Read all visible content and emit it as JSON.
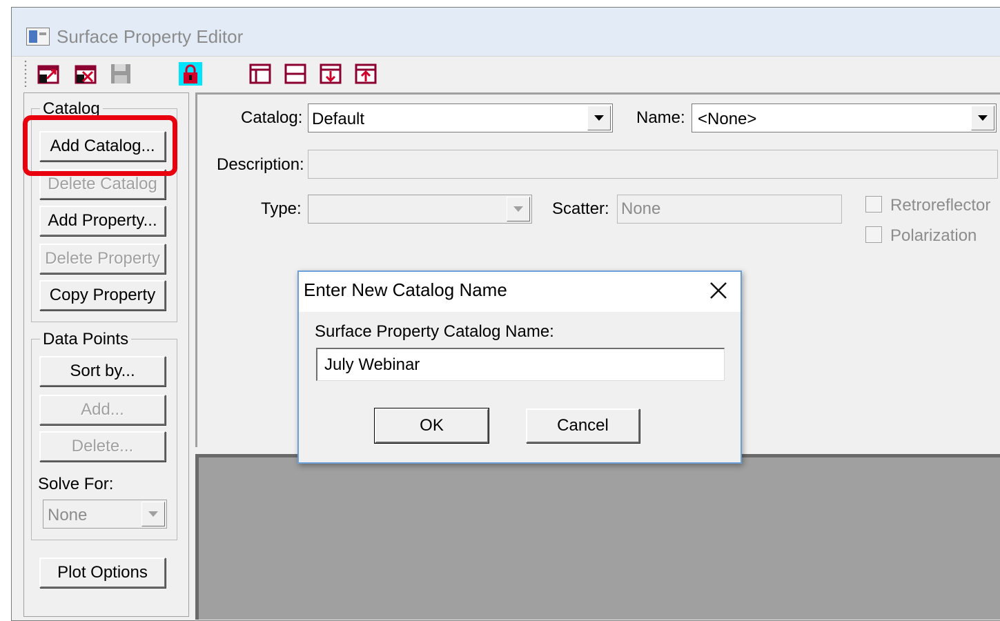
{
  "window": {
    "title": "Surface Property Editor"
  },
  "toolbar": {
    "icons": [
      "import-catalog-icon",
      "export-catalog-icon",
      "save-icon",
      "lock-icon",
      "layout-split-icon",
      "layout-rows-icon",
      "move-down-icon",
      "move-up-icon"
    ]
  },
  "catalog_group": {
    "label": "Catalog",
    "add_catalog": "Add Catalog...",
    "delete_catalog": "Delete Catalog",
    "add_property": "Add Property...",
    "delete_property": "Delete Property",
    "copy_property": "Copy Property"
  },
  "data_points_group": {
    "label": "Data Points",
    "sort_by": "Sort by...",
    "add": "Add...",
    "delete": "Delete...",
    "solve_for_label": "Solve For:",
    "solve_for_value": "None"
  },
  "plot_options": "Plot Options",
  "form": {
    "catalog_label": "Catalog:",
    "catalog_value": "Default",
    "name_label": "Name:",
    "name_value": "<None>",
    "description_label": "Description:",
    "description_value": "",
    "type_label": "Type:",
    "type_value": "",
    "scatter_label": "Scatter:",
    "scatter_value": "None",
    "retroreflector_label": "Retroreflector",
    "polarization_label": "Polarization"
  },
  "dialog": {
    "title": "Enter New Catalog Name",
    "field_label": "Surface Property Catalog Name:",
    "field_value": "July Webinar",
    "ok": "OK",
    "cancel": "Cancel"
  },
  "colors": {
    "highlight": "#e8000e",
    "dialog_border": "#6a9fd8",
    "window_bg": "#f0f0f0",
    "plot_bg": "#a0a0a0"
  }
}
